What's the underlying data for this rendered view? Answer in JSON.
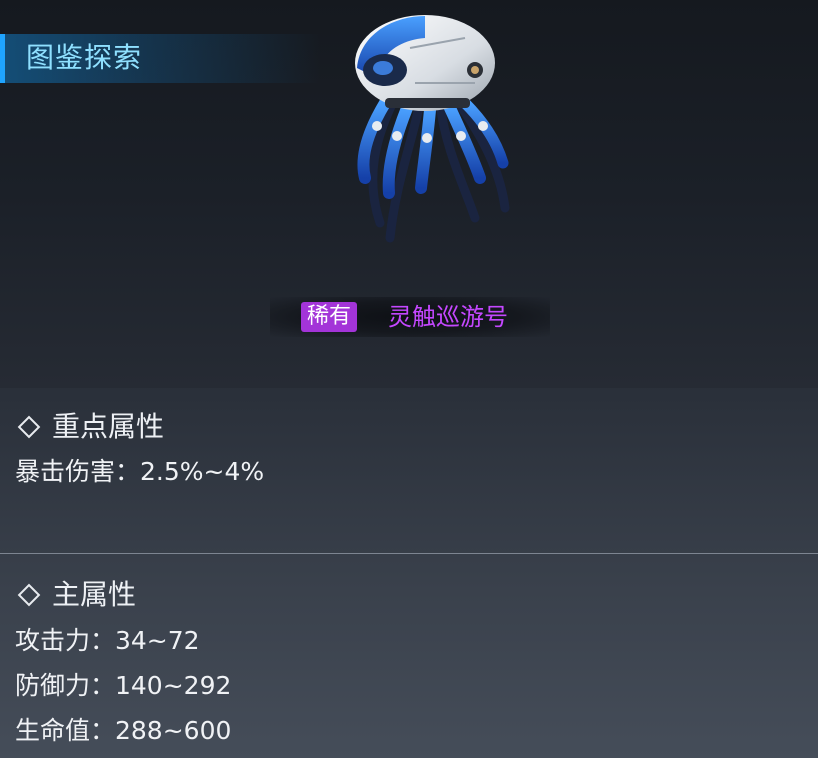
{
  "header": {
    "title": "图鉴探索"
  },
  "unit": {
    "rarity": "稀有",
    "name": "灵触巡游号",
    "rarity_color": "#a334d8",
    "name_color": "#c447ff",
    "portrait_icon": "mech-jellyfish-icon"
  },
  "key_attributes": {
    "title": "重点属性",
    "stats": [
      {
        "label": "暴击伤害：2.5%~4%"
      }
    ]
  },
  "main_attributes": {
    "title": "主属性",
    "stats": [
      {
        "label": "攻击力：34~72"
      },
      {
        "label": "防御力：140~292"
      },
      {
        "label": "生命值：288~600"
      }
    ]
  }
}
